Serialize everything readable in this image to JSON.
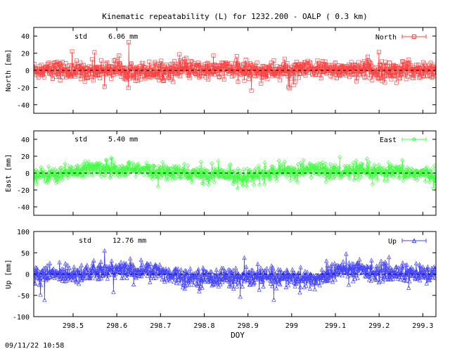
{
  "title": "Kinematic repeatability (L) for 1232.200 - OALP  (  0.3 km)",
  "timestamp": "09/11/22 10:58",
  "xlabel": "DOY",
  "colors": {
    "north": "#ff4444",
    "east": "#44ff44",
    "up": "#4444ff",
    "axis": "#000000",
    "zero_line": "#000000"
  },
  "chart_data": [
    {
      "type": "scatter",
      "title": "Kinematic repeatability (L) for 1232.200 - OALP  (  0.3 km)",
      "ylabel": "North [mm]",
      "xlabel": "",
      "series": [
        {
          "name": "North",
          "marker": "open-square",
          "line": "connected"
        }
      ],
      "std_label": "std",
      "std_value": "6.06 mm",
      "xlim": [
        298.41,
        299.33
      ],
      "ylim": [
        -50,
        50
      ],
      "yticks": [
        -40,
        -20,
        0,
        20,
        40
      ],
      "xticks": [
        298.5,
        298.6,
        298.7,
        298.8,
        298.9,
        299,
        299.1,
        299.2,
        299.3
      ],
      "xtick_labels_shown": false,
      "grid": false,
      "legend": "top-right",
      "std_mm": 6.06,
      "mean_mm": 0,
      "sample_count": 1080,
      "envelope_x": [
        298.41,
        298.45,
        298.5,
        298.55,
        298.6,
        298.65,
        298.7,
        298.75,
        298.8,
        298.85,
        298.9,
        298.95,
        299.0,
        299.05,
        299.1,
        299.15,
        299.2,
        299.25,
        299.3,
        299.33
      ],
      "envelope_mean": [
        0,
        1,
        -1,
        0,
        2,
        0,
        -1,
        1,
        0,
        1,
        0,
        -1,
        0,
        1,
        0,
        2,
        -1,
        0,
        1,
        0
      ]
    },
    {
      "type": "scatter",
      "ylabel": "East [mm]",
      "xlabel": "",
      "series": [
        {
          "name": "East",
          "marker": "open-diamond",
          "line": "connected"
        }
      ],
      "std_label": "std",
      "std_value": "5.40 mm",
      "xlim": [
        298.41,
        299.33
      ],
      "ylim": [
        -50,
        50
      ],
      "yticks": [
        -40,
        -20,
        0,
        20,
        40
      ],
      "xticks": [
        298.5,
        298.6,
        298.7,
        298.8,
        298.9,
        299,
        299.1,
        299.2,
        299.3
      ],
      "xtick_labels_shown": false,
      "grid": false,
      "legend": "top-right",
      "std_mm": 5.4,
      "mean_mm": 0,
      "sample_count": 1080,
      "envelope_x": [
        298.41,
        298.45,
        298.5,
        298.55,
        298.6,
        298.65,
        298.7,
        298.75,
        298.8,
        298.85,
        298.9,
        298.95,
        299.0,
        299.05,
        299.1,
        299.15,
        299.2,
        299.25,
        299.3,
        299.33
      ],
      "envelope_mean": [
        -3,
        -2,
        2,
        6,
        5,
        4,
        1,
        0,
        -2,
        -1,
        -4,
        0,
        2,
        5,
        1,
        2,
        0,
        1,
        -1,
        -3
      ]
    },
    {
      "type": "scatter",
      "ylabel": "Up [mm]",
      "xlabel": "DOY",
      "series": [
        {
          "name": "Up",
          "marker": "open-triangle",
          "line": "connected"
        }
      ],
      "std_label": "std",
      "std_value": "12.76 mm",
      "xlim": [
        298.41,
        299.33
      ],
      "ylim": [
        -100,
        100
      ],
      "yticks": [
        -100,
        -50,
        0,
        50,
        100
      ],
      "xticks": [
        298.5,
        298.6,
        298.7,
        298.8,
        298.9,
        299,
        299.1,
        299.2,
        299.3
      ],
      "xtick_labels": [
        "298.5",
        "298.6",
        "298.7",
        "298.8",
        "298.9",
        "299",
        "299.1",
        "299.2",
        "299.3"
      ],
      "xtick_labels_shown": true,
      "grid": false,
      "legend": "top-right",
      "std_mm": 12.76,
      "mean_mm": 0,
      "sample_count": 1080,
      "envelope_x": [
        298.41,
        298.45,
        298.5,
        298.55,
        298.6,
        298.65,
        298.7,
        298.75,
        298.8,
        298.85,
        298.9,
        298.95,
        299.0,
        299.05,
        299.1,
        299.15,
        299.2,
        299.25,
        299.3,
        299.33
      ],
      "envelope_mean": [
        -5,
        0,
        2,
        4,
        10,
        8,
        5,
        -5,
        -8,
        -6,
        -10,
        -5,
        -8,
        -15,
        8,
        10,
        5,
        3,
        0,
        -2
      ]
    }
  ]
}
